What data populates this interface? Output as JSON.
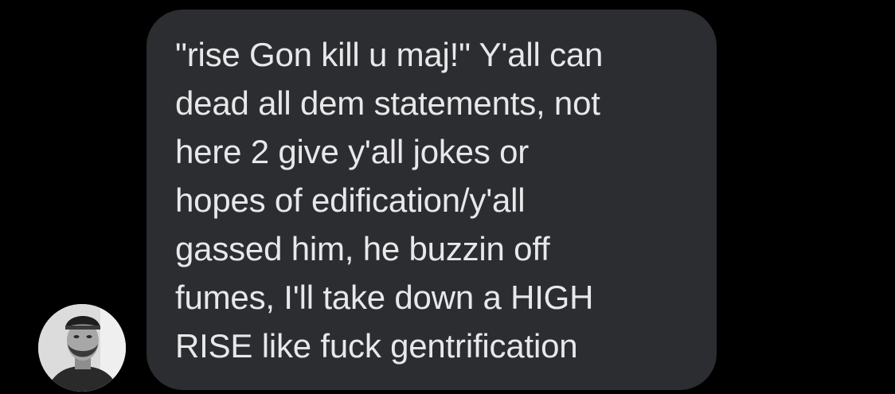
{
  "conversation": {
    "avatar": {
      "icon": "user-photo-avatar"
    },
    "message": {
      "lines": [
        "\"rise Gon kill u maj!\" Y'all can",
        "dead all dem statements, not",
        "here 2 give y'all jokes or",
        "hopes of edification/y'all",
        "gassed him, he buzzin off",
        "fumes, I'll take down a HIGH",
        "RISE like fuck gentrification"
      ],
      "bubble_color": "#2c2d30",
      "text_color": "#e8e8ea"
    }
  },
  "theme": {
    "background": "#000000"
  }
}
